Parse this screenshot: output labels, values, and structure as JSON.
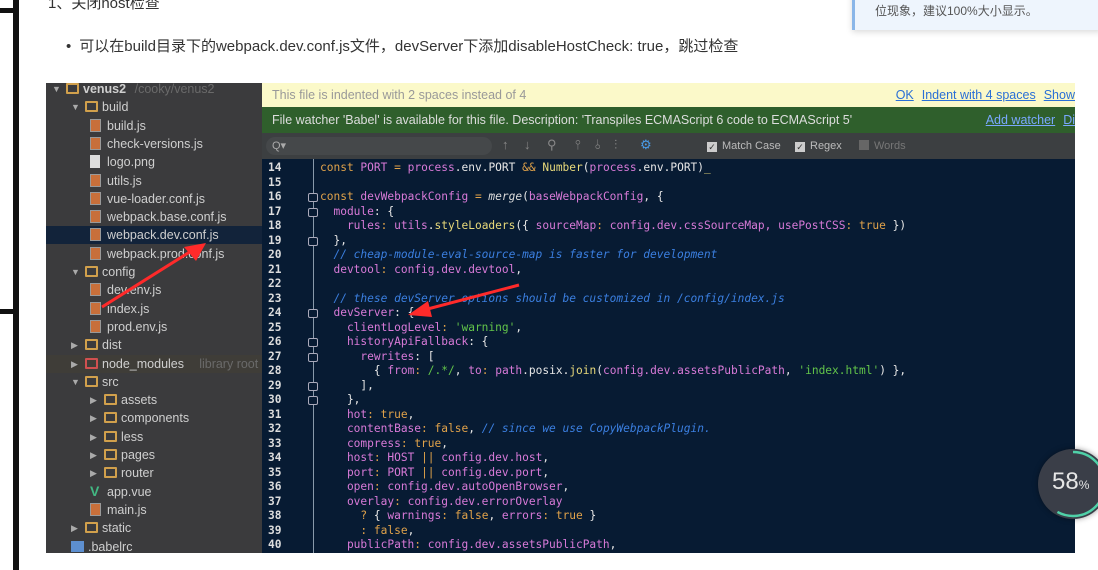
{
  "article": {
    "heading": "1、关闭host检查",
    "bullet": "可以在build目录下的webpack.dev.conf.js文件，devServer下添加disableHostCheck: true，跳过检查",
    "notice": "位现象，建议100%大小显示。"
  },
  "ide": {
    "tree": [
      {
        "depth": 0,
        "type": "folder",
        "open": true,
        "label": "venus2",
        "hint": "/cooky/venus2"
      },
      {
        "depth": 1,
        "type": "folder",
        "open": true,
        "label": "build"
      },
      {
        "depth": 2,
        "type": "js",
        "label": "build.js"
      },
      {
        "depth": 2,
        "type": "js",
        "label": "check-versions.js"
      },
      {
        "depth": 2,
        "type": "png",
        "label": "logo.png"
      },
      {
        "depth": 2,
        "type": "js",
        "label": "utils.js"
      },
      {
        "depth": 2,
        "type": "js",
        "label": "vue-loader.conf.js"
      },
      {
        "depth": 2,
        "type": "js",
        "label": "webpack.base.conf.js"
      },
      {
        "depth": 2,
        "type": "js",
        "label": "webpack.dev.conf.js",
        "selected": true
      },
      {
        "depth": 2,
        "type": "js",
        "label": "webpack.prod.conf.js"
      },
      {
        "depth": 1,
        "type": "folder",
        "open": true,
        "label": "config"
      },
      {
        "depth": 2,
        "type": "js",
        "label": "dev.env.js"
      },
      {
        "depth": 2,
        "type": "js",
        "label": "index.js"
      },
      {
        "depth": 2,
        "type": "js",
        "label": "prod.env.js"
      },
      {
        "depth": 1,
        "type": "folder",
        "open": false,
        "label": "dist"
      },
      {
        "depth": 1,
        "type": "folder-red",
        "open": false,
        "label": "node_modules",
        "hint": "library root"
      },
      {
        "depth": 1,
        "type": "folder",
        "open": true,
        "label": "src"
      },
      {
        "depth": 2,
        "type": "folder",
        "open": false,
        "label": "assets"
      },
      {
        "depth": 2,
        "type": "folder",
        "open": false,
        "label": "components"
      },
      {
        "depth": 2,
        "type": "folder",
        "open": false,
        "label": "less"
      },
      {
        "depth": 2,
        "type": "folder",
        "open": false,
        "label": "pages"
      },
      {
        "depth": 2,
        "type": "folder",
        "open": false,
        "label": "router"
      },
      {
        "depth": 2,
        "type": "vue",
        "label": "app.vue"
      },
      {
        "depth": 2,
        "type": "js",
        "label": "main.js"
      },
      {
        "depth": 1,
        "type": "folder",
        "open": false,
        "label": "static"
      },
      {
        "depth": 1,
        "type": "rc",
        "label": ".babelrc"
      }
    ],
    "indent_banner": {
      "text": "This file is indented with 2 spaces instead of 4",
      "ok": "OK",
      "indent4": "Indent with 4 spaces",
      "show": "Show"
    },
    "watcher_banner": {
      "text": "File watcher 'Babel' is available for this file. Description: 'Transpiles ECMAScript 6 code to ECMAScript 5'",
      "add": "Add watcher",
      "dismiss": "Di"
    },
    "search": {
      "placeholder": "Q▾",
      "match_case": "Match Case",
      "regex": "Regex",
      "words": "Words",
      "match_case_checked": true,
      "regex_checked": true,
      "words_checked": false
    },
    "code": [
      {
        "n": "14",
        "fold": false,
        "t": [
          [
            "const ",
            "k"
          ],
          [
            "PORT ",
            "p"
          ],
          [
            "= ",
            "k"
          ],
          [
            "process",
            "p"
          ],
          [
            ".env.",
            "w"
          ],
          [
            "PORT ",
            "w"
          ],
          [
            "&& ",
            "k"
          ],
          [
            "Number",
            "f"
          ],
          [
            "(",
            "w"
          ],
          [
            "process",
            "p"
          ],
          [
            ".env.PORT)",
            "w"
          ],
          [
            "_",
            "f"
          ]
        ]
      },
      {
        "n": "15",
        "fold": false,
        "t": []
      },
      {
        "n": "16",
        "fold": true,
        "t": [
          [
            "const ",
            "k"
          ],
          [
            "devWebpackConfig ",
            "p"
          ],
          [
            "= ",
            "k"
          ],
          [
            "merge",
            "i"
          ],
          [
            "(",
            "w"
          ],
          [
            "baseWebpackConfig",
            "p"
          ],
          [
            ", {",
            "w"
          ]
        ]
      },
      {
        "n": "17",
        "fold": true,
        "t": [
          [
            "  module",
            "p"
          ],
          [
            ": {",
            "w"
          ]
        ]
      },
      {
        "n": "18",
        "fold": false,
        "t": [
          [
            "    rules",
            "p"
          ],
          [
            ": ",
            "k"
          ],
          [
            "utils",
            "p"
          ],
          [
            ".",
            "w"
          ],
          [
            "styleLoaders",
            "f"
          ],
          [
            "({ ",
            "w"
          ],
          [
            "sourceMap",
            "p"
          ],
          [
            ": ",
            "k"
          ],
          [
            "config",
            "p"
          ],
          [
            ".dev.cssSourceMap, ",
            "p"
          ],
          [
            "usePostCSS",
            "p"
          ],
          [
            ": ",
            "k"
          ],
          [
            "true",
            "k"
          ],
          [
            " })",
            "w"
          ]
        ]
      },
      {
        "n": "19",
        "fold": true,
        "t": [
          [
            "  },",
            "w"
          ]
        ]
      },
      {
        "n": "20",
        "fold": false,
        "t": [
          [
            "  // cheap-module-eval-source-map is faster for development",
            "c"
          ]
        ]
      },
      {
        "n": "21",
        "fold": false,
        "t": [
          [
            "  devtool",
            "p"
          ],
          [
            ": ",
            "k"
          ],
          [
            "config.dev.devtool",
            "p"
          ],
          [
            ",",
            "w"
          ]
        ]
      },
      {
        "n": "22",
        "fold": false,
        "t": []
      },
      {
        "n": "23",
        "fold": false,
        "t": [
          [
            "  // these devServer options should be customized in /config/index.js",
            "c"
          ]
        ]
      },
      {
        "n": "24",
        "fold": true,
        "t": [
          [
            "  devServer",
            "p"
          ],
          [
            ": {",
            "w"
          ]
        ]
      },
      {
        "n": "25",
        "fold": false,
        "t": [
          [
            "    clientLogLevel",
            "p"
          ],
          [
            ": ",
            "k"
          ],
          [
            "'warning'",
            "s"
          ],
          [
            ",",
            "w"
          ]
        ]
      },
      {
        "n": "26",
        "fold": true,
        "t": [
          [
            "    historyApiFallback",
            "p"
          ],
          [
            ": {",
            "w"
          ]
        ]
      },
      {
        "n": "27",
        "fold": true,
        "t": [
          [
            "      rewrites",
            "p"
          ],
          [
            ": [",
            "w"
          ]
        ]
      },
      {
        "n": "28",
        "fold": false,
        "t": [
          [
            "        { ",
            "w"
          ],
          [
            "from",
            "p"
          ],
          [
            ": ",
            "k"
          ],
          [
            "/.*/",
            "s"
          ],
          [
            ", ",
            "w"
          ],
          [
            "to",
            "p"
          ],
          [
            ": ",
            "k"
          ],
          [
            "path",
            "p"
          ],
          [
            ".posix.",
            "w"
          ],
          [
            "join",
            "f"
          ],
          [
            "(",
            "w"
          ],
          [
            "config.dev.assetsPublicPath",
            "p"
          ],
          [
            ", ",
            "w"
          ],
          [
            "'index.html'",
            "s"
          ],
          [
            ") },",
            "w"
          ]
        ]
      },
      {
        "n": "29",
        "fold": true,
        "t": [
          [
            "      ],",
            "w"
          ]
        ]
      },
      {
        "n": "30",
        "fold": true,
        "t": [
          [
            "    },",
            "w"
          ]
        ]
      },
      {
        "n": "31",
        "fold": false,
        "t": [
          [
            "    hot",
            "p"
          ],
          [
            ": ",
            "k"
          ],
          [
            "true",
            "k"
          ],
          [
            ",",
            "w"
          ]
        ]
      },
      {
        "n": "32",
        "fold": false,
        "t": [
          [
            "    contentBase",
            "p"
          ],
          [
            ": ",
            "k"
          ],
          [
            "false",
            "k"
          ],
          [
            ", ",
            "w"
          ],
          [
            "// since we use CopyWebpackPlugin.",
            "c"
          ]
        ]
      },
      {
        "n": "33",
        "fold": false,
        "t": [
          [
            "    compress",
            "p"
          ],
          [
            ": ",
            "k"
          ],
          [
            "true",
            "k"
          ],
          [
            ",",
            "w"
          ]
        ]
      },
      {
        "n": "34",
        "fold": false,
        "t": [
          [
            "    host",
            "p"
          ],
          [
            ": ",
            "k"
          ],
          [
            "HOST ",
            "p"
          ],
          [
            "|| ",
            "k"
          ],
          [
            "config.dev.host",
            "p"
          ],
          [
            ",",
            "w"
          ]
        ]
      },
      {
        "n": "35",
        "fold": false,
        "t": [
          [
            "    port",
            "p"
          ],
          [
            ": ",
            "k"
          ],
          [
            "PORT ",
            "p"
          ],
          [
            "|| ",
            "k"
          ],
          [
            "config.dev.port",
            "p"
          ],
          [
            ",",
            "w"
          ]
        ]
      },
      {
        "n": "36",
        "fold": false,
        "t": [
          [
            "    open",
            "p"
          ],
          [
            ": ",
            "k"
          ],
          [
            "config.dev.autoOpenBrowser",
            "p"
          ],
          [
            ",",
            "w"
          ]
        ]
      },
      {
        "n": "37",
        "fold": false,
        "t": [
          [
            "    overlay",
            "p"
          ],
          [
            ": ",
            "k"
          ],
          [
            "config.dev.errorOverlay",
            "p"
          ]
        ]
      },
      {
        "n": "38",
        "fold": false,
        "t": [
          [
            "      ? ",
            "k"
          ],
          [
            "{ ",
            "w"
          ],
          [
            "warnings",
            "p"
          ],
          [
            ": ",
            "k"
          ],
          [
            "false",
            "k"
          ],
          [
            ", ",
            "w"
          ],
          [
            "errors",
            "p"
          ],
          [
            ": ",
            "k"
          ],
          [
            "true",
            "k"
          ],
          [
            " }",
            "w"
          ]
        ]
      },
      {
        "n": "39",
        "fold": false,
        "t": [
          [
            "      : ",
            "k"
          ],
          [
            "false",
            "k"
          ],
          [
            ",",
            "w"
          ]
        ]
      },
      {
        "n": "40",
        "fold": false,
        "t": [
          [
            "    publicPath",
            "p"
          ],
          [
            ": ",
            "k"
          ],
          [
            "config.dev.assetsPublicPath",
            "p"
          ],
          [
            ",",
            "w"
          ]
        ]
      }
    ]
  },
  "progress": {
    "value": 58,
    "unit": "%"
  },
  "colors": {
    "accent_arrow": "#ff2a2a",
    "gauge_track": "#4fd1a8"
  }
}
